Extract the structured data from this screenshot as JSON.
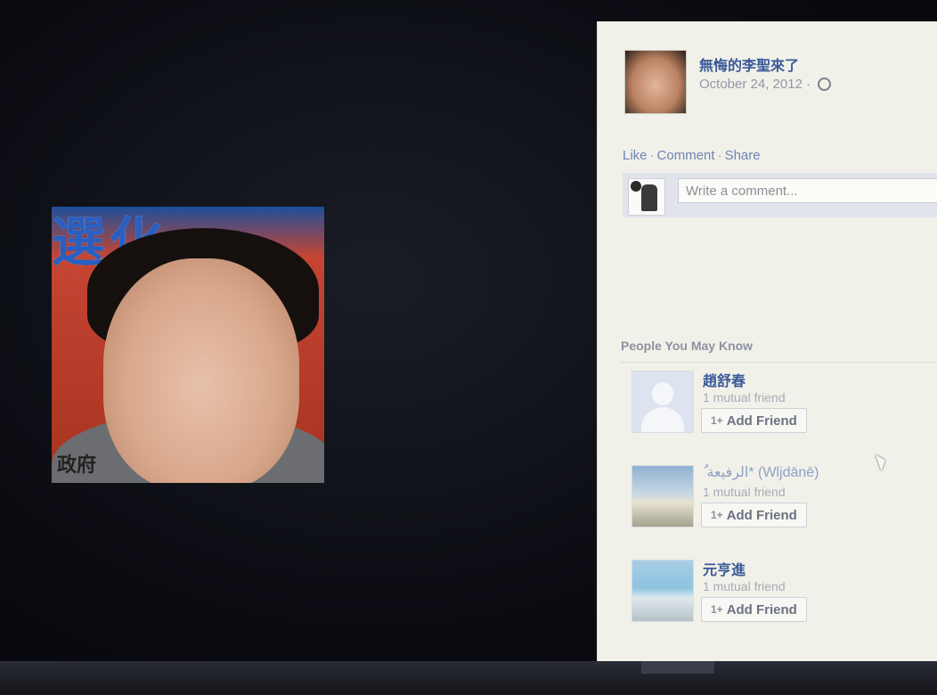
{
  "post": {
    "author": "無悔的李聖來了",
    "date": "October 24, 2012",
    "date_separator": "·",
    "privacy_icon": "globe-icon",
    "actions": {
      "like": "Like",
      "comment": "Comment",
      "share": "Share",
      "separator": "·"
    },
    "comment_placeholder": "Write a comment..."
  },
  "photo": {
    "banner_text": "選 化",
    "caption_text": "政府"
  },
  "pymk": {
    "title": "People You May Know",
    "people": [
      {
        "name": "趙舒春",
        "mutual": "1 mutual friend",
        "button": "Add Friend",
        "photo": "silhouette"
      },
      {
        "name": "ٌ الرفيعة* (Wljdānē)",
        "mutual": "1 mutual friend",
        "button": "Add Friend",
        "photo": "beach"
      },
      {
        "name": "元亨進",
        "mutual": "1 mutual friend",
        "button": "Add Friend",
        "photo": "city"
      }
    ],
    "add_icon": "add-friend-icon"
  },
  "colors": {
    "link_blue": "#3b5998",
    "panel_bg": "#f1f1e9",
    "screen_bg": "#0b0c12"
  }
}
